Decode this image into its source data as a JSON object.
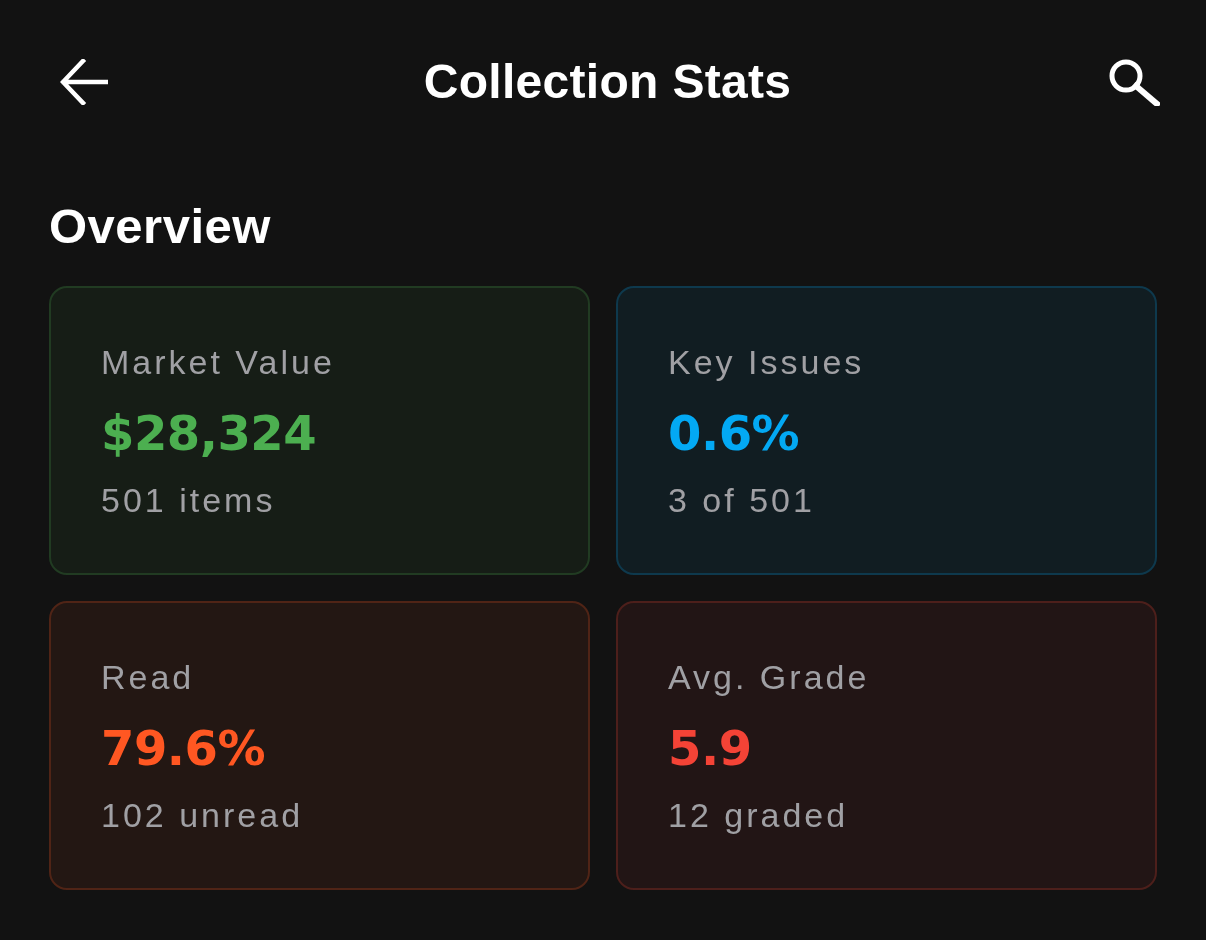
{
  "app_bar": {
    "title": "Collection Stats"
  },
  "section": {
    "title": "Overview"
  },
  "cards": [
    {
      "label": "Market Value",
      "value": "$28,324",
      "detail": "501 items",
      "color": "#4caf50"
    },
    {
      "label": "Key Issues",
      "value": "0.6%",
      "detail": "3 of 501",
      "color": "#03a9f4"
    },
    {
      "label": "Read",
      "value": "79.6%",
      "detail": "102 unread",
      "color": "#ff5722"
    },
    {
      "label": "Avg. Grade",
      "value": "5.9",
      "detail": "12 graded",
      "color": "#f44336"
    }
  ]
}
